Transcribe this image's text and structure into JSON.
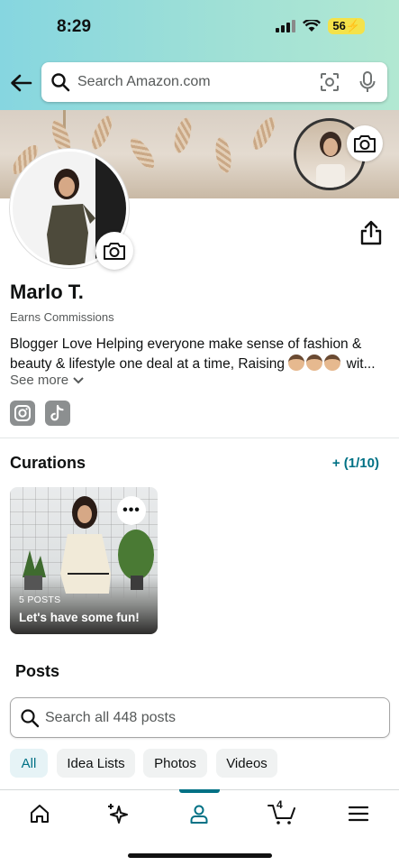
{
  "status_bar": {
    "time": "8:29",
    "battery": "56"
  },
  "search": {
    "placeholder": "Search Amazon.com"
  },
  "profile": {
    "name": "Marlo T.",
    "earns": "Earns Commissions",
    "bio_line1": "Blogger Love Helping everyone make sense of fashion &",
    "bio_line2": "beauty & lifestyle one deal at a time, Raising",
    "bio_ellipsis": " wit...",
    "see_more": "See more"
  },
  "curations": {
    "title": "Curations",
    "add_label": "+ (1/10)",
    "card": {
      "count": "5 POSTS",
      "title": "Let's have some fun!"
    }
  },
  "posts": {
    "title": "Posts",
    "search_placeholder": "Search all 448 posts",
    "chips": [
      "All",
      "Idea Lists",
      "Photos",
      "Videos"
    ],
    "active_chip": "All"
  },
  "tabbar": {
    "cart_count": "4"
  },
  "colors": {
    "accent": "#007185",
    "header_gradient_start": "#86d6e0",
    "header_gradient_end": "#b2e8d2"
  },
  "icons": [
    "back-arrow-icon",
    "search-icon",
    "camera-scan-icon",
    "microphone-icon",
    "camera-icon",
    "share-icon",
    "chevron-down-icon",
    "instagram-icon",
    "tiktok-icon",
    "more-icon",
    "home-icon",
    "sparkle-icon",
    "profile-icon",
    "cart-icon",
    "menu-icon"
  ]
}
